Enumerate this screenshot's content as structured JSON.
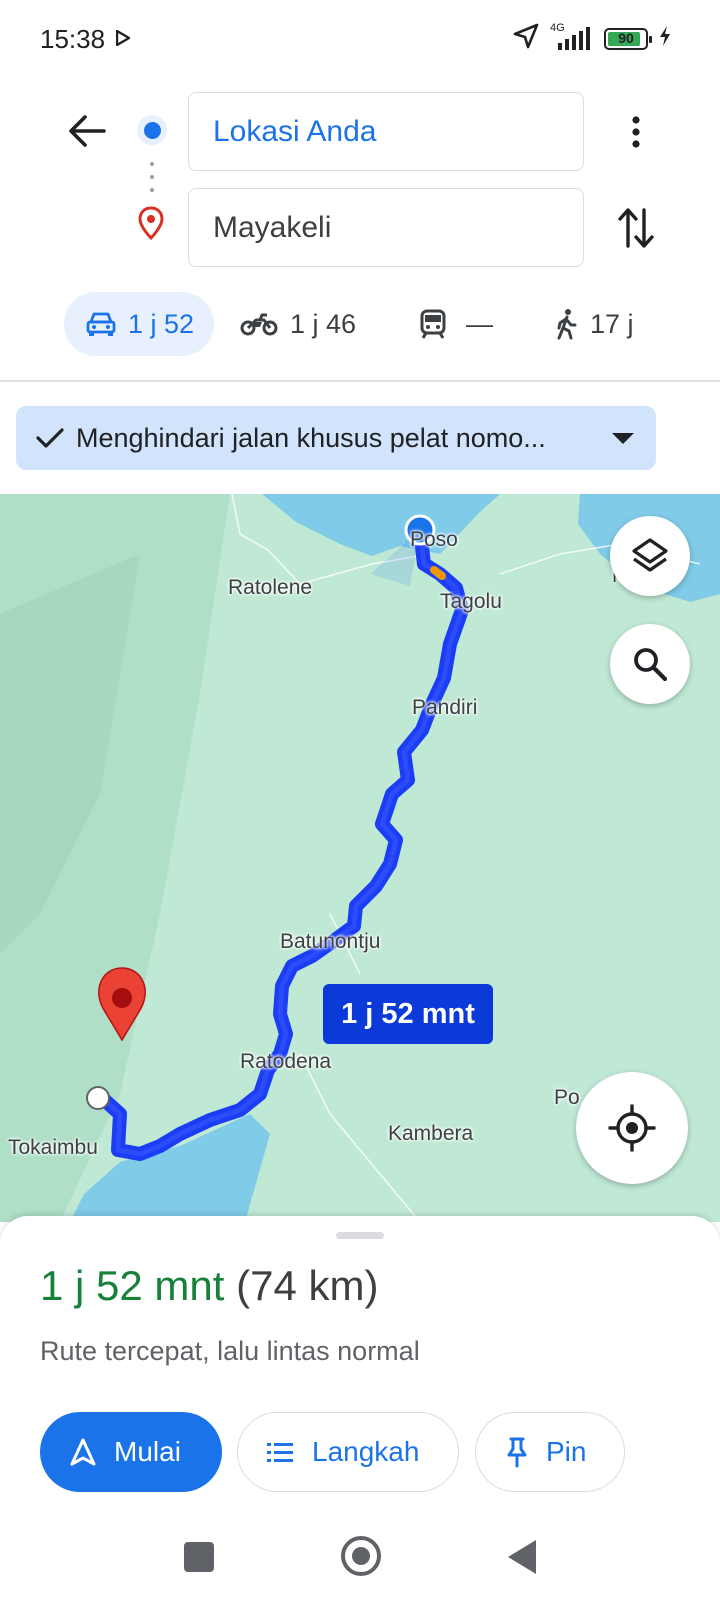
{
  "status_bar": {
    "time": "15:38",
    "network": "4G",
    "battery_level": "90",
    "battery_fraction": 0.9
  },
  "directions": {
    "origin": "Lokasi Anda",
    "destination": "Mayakeli"
  },
  "modes": [
    {
      "icon": "car-icon",
      "label": "1 j 52",
      "selected": true
    },
    {
      "icon": "motorcycle-icon",
      "label": "1 j 46",
      "selected": false
    },
    {
      "icon": "train-icon",
      "label": "—",
      "selected": false
    },
    {
      "icon": "walking-icon",
      "label": "17 j",
      "selected": false
    }
  ],
  "avoid_chip": {
    "label": "Menghindari jalan khusus pelat nomo..."
  },
  "map": {
    "places": {
      "poso": "Poso",
      "ratolene": "Ratolene",
      "tagolu": "Tagolu",
      "pandiri": "Pandiri",
      "batunontju": "Batunontju",
      "ratodena": "Ratodena",
      "kambera": "Kambera",
      "tokaimbu": "Tokaimbu",
      "po_partial": "Po",
      "m_partial": "M"
    },
    "eta_label": "1 j 52 mnt",
    "colors": {
      "land": "#b8e8d0",
      "water": "#7fc8e6",
      "route": "#1a3df5",
      "destination_marker": "#ea4335"
    }
  },
  "summary": {
    "duration": "1 j 52 mnt",
    "distance": "(74 km)",
    "description": "Rute tercepat, lalu lintas normal"
  },
  "actions": {
    "start": "Mulai",
    "steps": "Langkah",
    "pin": "Pin"
  }
}
